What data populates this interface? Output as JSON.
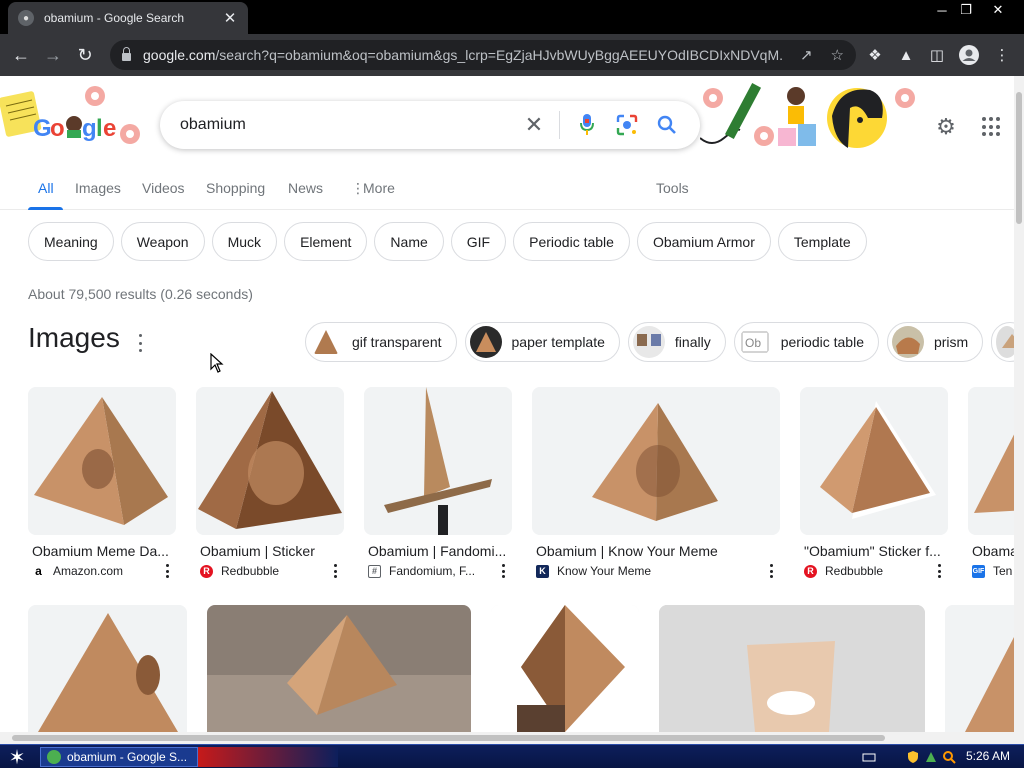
{
  "browser": {
    "tab_title": "obamium - Google Search",
    "url_host": "google.com",
    "url_rest": "/search?q=obamium&oq=obamium&gs_lcrp=EgZjaHJvbWUyBggAEEUYOdIBCDIxNDVqM..."
  },
  "search": {
    "query": "obamium"
  },
  "nav_tabs": [
    "All",
    "Images",
    "Videos",
    "Shopping",
    "News",
    "More",
    "Tools"
  ],
  "chips": [
    "Meaning",
    "Weapon",
    "Muck",
    "Element",
    "Name",
    "GIF",
    "Periodic table",
    "Obamium Armor",
    "Template"
  ],
  "stats": "About 79,500 results (0.26 seconds)",
  "images_heading": "Images",
  "suggestions": [
    "gif transparent",
    "paper template",
    "finally",
    "periodic table",
    "prism"
  ],
  "results": [
    {
      "title": "Obamium Meme Da...",
      "source": "Amazon.com"
    },
    {
      "title": "Obamium | Sticker",
      "source": "Redbubble"
    },
    {
      "title": "Obamium | Fandomi...",
      "source": "Fandomium, F..."
    },
    {
      "title": "Obamium | Know Your Meme",
      "source": "Know Your Meme"
    },
    {
      "title": "\"Obamium\" Sticker f...",
      "source": "Redbubble"
    },
    {
      "title": "Obama",
      "source": "Ten"
    }
  ],
  "taskbar": {
    "item": "obamium - Google S...",
    "clock": "5:26 AM"
  },
  "colors": {
    "accent": "#1a73e8",
    "browser_dark": "#35363a"
  }
}
